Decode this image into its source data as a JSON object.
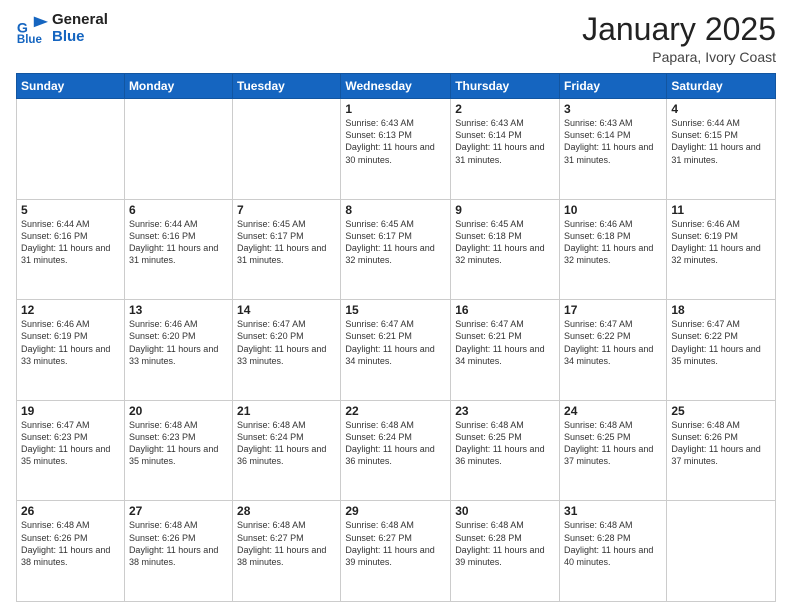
{
  "logo": {
    "line1": "General",
    "line2": "Blue"
  },
  "header": {
    "month": "January 2025",
    "location": "Papara, Ivory Coast"
  },
  "weekdays": [
    "Sunday",
    "Monday",
    "Tuesday",
    "Wednesday",
    "Thursday",
    "Friday",
    "Saturday"
  ],
  "weeks": [
    [
      {
        "day": "",
        "info": ""
      },
      {
        "day": "",
        "info": ""
      },
      {
        "day": "",
        "info": ""
      },
      {
        "day": "1",
        "info": "Sunrise: 6:43 AM\nSunset: 6:13 PM\nDaylight: 11 hours\nand 30 minutes."
      },
      {
        "day": "2",
        "info": "Sunrise: 6:43 AM\nSunset: 6:14 PM\nDaylight: 11 hours\nand 31 minutes."
      },
      {
        "day": "3",
        "info": "Sunrise: 6:43 AM\nSunset: 6:14 PM\nDaylight: 11 hours\nand 31 minutes."
      },
      {
        "day": "4",
        "info": "Sunrise: 6:44 AM\nSunset: 6:15 PM\nDaylight: 11 hours\nand 31 minutes."
      }
    ],
    [
      {
        "day": "5",
        "info": "Sunrise: 6:44 AM\nSunset: 6:16 PM\nDaylight: 11 hours\nand 31 minutes."
      },
      {
        "day": "6",
        "info": "Sunrise: 6:44 AM\nSunset: 6:16 PM\nDaylight: 11 hours\nand 31 minutes."
      },
      {
        "day": "7",
        "info": "Sunrise: 6:45 AM\nSunset: 6:17 PM\nDaylight: 11 hours\nand 31 minutes."
      },
      {
        "day": "8",
        "info": "Sunrise: 6:45 AM\nSunset: 6:17 PM\nDaylight: 11 hours\nand 32 minutes."
      },
      {
        "day": "9",
        "info": "Sunrise: 6:45 AM\nSunset: 6:18 PM\nDaylight: 11 hours\nand 32 minutes."
      },
      {
        "day": "10",
        "info": "Sunrise: 6:46 AM\nSunset: 6:18 PM\nDaylight: 11 hours\nand 32 minutes."
      },
      {
        "day": "11",
        "info": "Sunrise: 6:46 AM\nSunset: 6:19 PM\nDaylight: 11 hours\nand 32 minutes."
      }
    ],
    [
      {
        "day": "12",
        "info": "Sunrise: 6:46 AM\nSunset: 6:19 PM\nDaylight: 11 hours\nand 33 minutes."
      },
      {
        "day": "13",
        "info": "Sunrise: 6:46 AM\nSunset: 6:20 PM\nDaylight: 11 hours\nand 33 minutes."
      },
      {
        "day": "14",
        "info": "Sunrise: 6:47 AM\nSunset: 6:20 PM\nDaylight: 11 hours\nand 33 minutes."
      },
      {
        "day": "15",
        "info": "Sunrise: 6:47 AM\nSunset: 6:21 PM\nDaylight: 11 hours\nand 34 minutes."
      },
      {
        "day": "16",
        "info": "Sunrise: 6:47 AM\nSunset: 6:21 PM\nDaylight: 11 hours\nand 34 minutes."
      },
      {
        "day": "17",
        "info": "Sunrise: 6:47 AM\nSunset: 6:22 PM\nDaylight: 11 hours\nand 34 minutes."
      },
      {
        "day": "18",
        "info": "Sunrise: 6:47 AM\nSunset: 6:22 PM\nDaylight: 11 hours\nand 35 minutes."
      }
    ],
    [
      {
        "day": "19",
        "info": "Sunrise: 6:47 AM\nSunset: 6:23 PM\nDaylight: 11 hours\nand 35 minutes."
      },
      {
        "day": "20",
        "info": "Sunrise: 6:48 AM\nSunset: 6:23 PM\nDaylight: 11 hours\nand 35 minutes."
      },
      {
        "day": "21",
        "info": "Sunrise: 6:48 AM\nSunset: 6:24 PM\nDaylight: 11 hours\nand 36 minutes."
      },
      {
        "day": "22",
        "info": "Sunrise: 6:48 AM\nSunset: 6:24 PM\nDaylight: 11 hours\nand 36 minutes."
      },
      {
        "day": "23",
        "info": "Sunrise: 6:48 AM\nSunset: 6:25 PM\nDaylight: 11 hours\nand 36 minutes."
      },
      {
        "day": "24",
        "info": "Sunrise: 6:48 AM\nSunset: 6:25 PM\nDaylight: 11 hours\nand 37 minutes."
      },
      {
        "day": "25",
        "info": "Sunrise: 6:48 AM\nSunset: 6:26 PM\nDaylight: 11 hours\nand 37 minutes."
      }
    ],
    [
      {
        "day": "26",
        "info": "Sunrise: 6:48 AM\nSunset: 6:26 PM\nDaylight: 11 hours\nand 38 minutes."
      },
      {
        "day": "27",
        "info": "Sunrise: 6:48 AM\nSunset: 6:26 PM\nDaylight: 11 hours\nand 38 minutes."
      },
      {
        "day": "28",
        "info": "Sunrise: 6:48 AM\nSunset: 6:27 PM\nDaylight: 11 hours\nand 38 minutes."
      },
      {
        "day": "29",
        "info": "Sunrise: 6:48 AM\nSunset: 6:27 PM\nDaylight: 11 hours\nand 39 minutes."
      },
      {
        "day": "30",
        "info": "Sunrise: 6:48 AM\nSunset: 6:28 PM\nDaylight: 11 hours\nand 39 minutes."
      },
      {
        "day": "31",
        "info": "Sunrise: 6:48 AM\nSunset: 6:28 PM\nDaylight: 11 hours\nand 40 minutes."
      },
      {
        "day": "",
        "info": ""
      }
    ]
  ]
}
